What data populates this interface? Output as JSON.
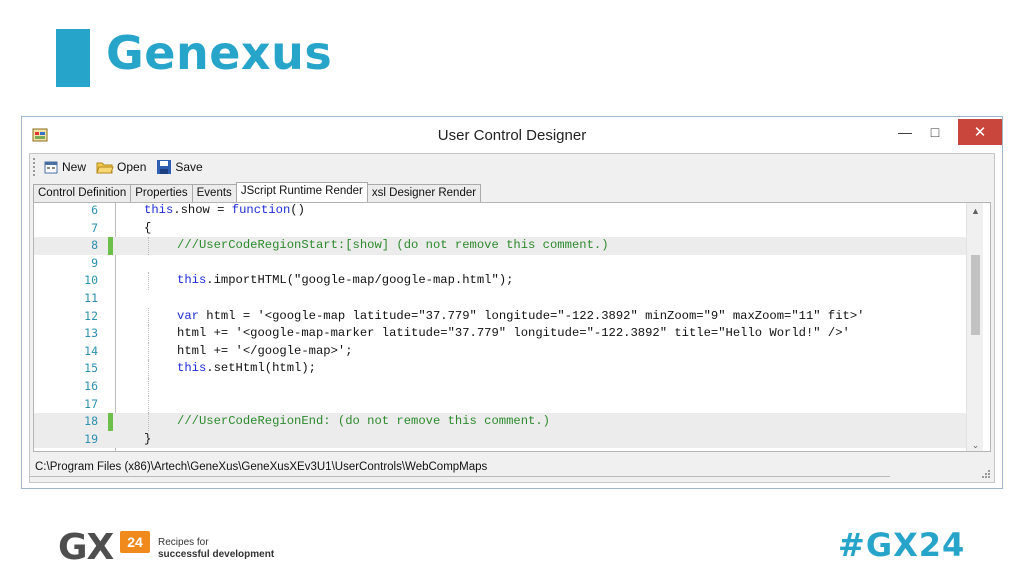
{
  "slide": {
    "title": "Genexus",
    "hashtag": "#GX24",
    "logo": {
      "mark": "GX",
      "badge": "24",
      "tagline_1": "Recipes for",
      "tagline_2": "successful development"
    },
    "accent_color": "#27a4c9"
  },
  "window": {
    "title": "User Control Designer",
    "icons": {
      "app": "form-designer-icon",
      "minimize": "minimize-icon",
      "maximize": "maximize-icon",
      "close": "close-icon"
    },
    "toolbar": {
      "new_label": "New",
      "open_label": "Open",
      "save_label": "Save"
    },
    "tabs": [
      {
        "label": "Control Definition",
        "active": false
      },
      {
        "label": "Properties",
        "active": false
      },
      {
        "label": "Events",
        "active": false
      },
      {
        "label": "JScript Runtime Render",
        "active": true
      },
      {
        "label": "xsl Designer Render",
        "active": false
      }
    ],
    "status_path": "C:\\Program Files (x86)\\Artech\\GeneXus\\GeneXusXEv3U1\\UserControls\\WebCompMaps"
  },
  "code": [
    {
      "n": "6",
      "text": "this.show = function()"
    },
    {
      "n": "7",
      "text": "{"
    },
    {
      "n": "8",
      "text": "///UserCodeRegionStart:[show] (do not remove this comment.)"
    },
    {
      "n": "9",
      "text": ""
    },
    {
      "n": "10",
      "text": "this.importHTML(\"google-map/google-map.html\");"
    },
    {
      "n": "11",
      "text": ""
    },
    {
      "n": "12",
      "text": "var html = '<google-map latitude=\"37.779\" longitude=\"-122.3892\" minZoom=\"9\" maxZoom=\"11\" fit>'"
    },
    {
      "n": "13",
      "text": "html += '<google-map-marker latitude=\"37.779\" longitude=\"-122.3892\" title=\"Hello World!\" />'"
    },
    {
      "n": "14",
      "text": "html += '</google-map>';"
    },
    {
      "n": "15",
      "text": "this.setHtml(html);"
    },
    {
      "n": "16",
      "text": ""
    },
    {
      "n": "17",
      "text": ""
    },
    {
      "n": "18",
      "text": "///UserCodeRegionEnd: (do not remove this comment.)"
    },
    {
      "n": "19",
      "text": "}"
    }
  ],
  "colors": {
    "keyword": "#1d2bd8",
    "comment": "#2c8a2c",
    "line_number": "#2b91af",
    "close_button": "#c9463d"
  }
}
